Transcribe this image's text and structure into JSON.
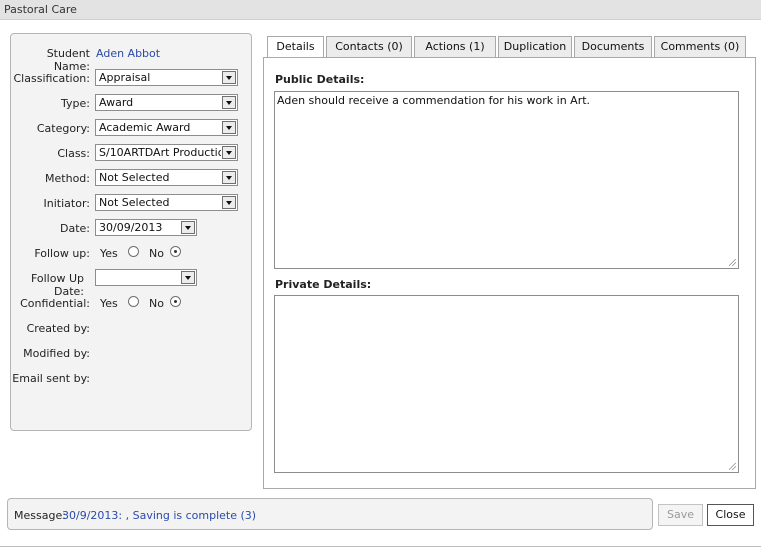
{
  "window": {
    "title": "Pastoral Care"
  },
  "form": {
    "student_name": {
      "label": "Student Name:",
      "value": "Aden Abbot"
    },
    "classification": {
      "label": "Classification:",
      "value": "Appraisal"
    },
    "type": {
      "label": "Type:",
      "value": "Award"
    },
    "category": {
      "label": "Category:",
      "value": "Academic Award"
    },
    "class": {
      "label": "Class:",
      "value": "S/10ARTDArt Production"
    },
    "method": {
      "label": "Method:",
      "value": "Not Selected"
    },
    "initiator": {
      "label": "Initiator:",
      "value": "Not Selected"
    },
    "date": {
      "label": "Date:",
      "value": "30/09/2013"
    },
    "follow_up": {
      "label": "Follow up:",
      "yes": "Yes",
      "no": "No",
      "selected": "No"
    },
    "follow_up_date": {
      "label": "Follow Up Date:",
      "value": ""
    },
    "confidential": {
      "label": "Confidential:",
      "yes": "Yes",
      "no": "No",
      "selected": "No"
    },
    "created_by": {
      "label": "Created by:"
    },
    "modified_by": {
      "label": "Modified by:"
    },
    "email_sent_by": {
      "label": "Email sent by:"
    }
  },
  "tabs": [
    {
      "label": "Details",
      "active": true
    },
    {
      "label": "Contacts (0)"
    },
    {
      "label": "Actions (1)"
    },
    {
      "label": "Duplication"
    },
    {
      "label": "Documents"
    },
    {
      "label": "Comments (0)"
    }
  ],
  "details": {
    "public_title": "Public Details:",
    "public_text": "Aden should receive a commendation for his work in Art.",
    "private_title": "Private Details:",
    "private_text": ""
  },
  "status": {
    "label": "Message:",
    "message": "30/9/2013: , Saving is complete (3)"
  },
  "buttons": {
    "save": "Save",
    "close": "Close"
  }
}
